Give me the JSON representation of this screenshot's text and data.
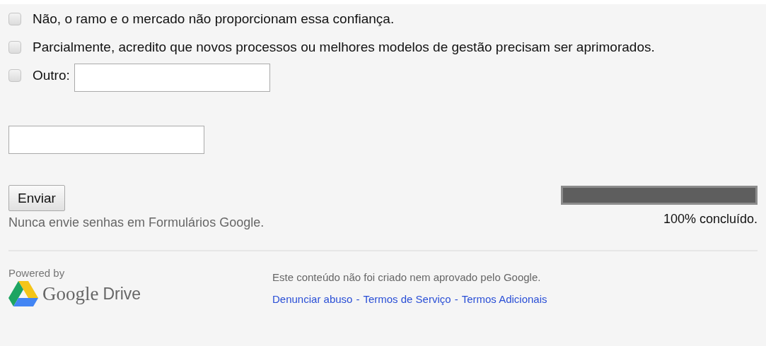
{
  "options": [
    {
      "kind": "plain",
      "label": "Não, o ramo e o mercado não proporcionam essa confiança.",
      "checked": false
    },
    {
      "kind": "plain",
      "label": "Parcialmente, acredito que novos processos ou melhores modelos de gestão precisam ser aprimorados.",
      "checked": false
    },
    {
      "kind": "other",
      "label": "Outro:",
      "checked": false
    }
  ],
  "extra_field": {
    "kind": "text"
  },
  "submit": {
    "label": "Enviar"
  },
  "warning": "Nunca envie senhas em Formulários Google.",
  "progress": {
    "level": 1,
    "label": "100% concluído."
  },
  "footer": {
    "powered_by": "Powered by",
    "logo_word": "Google",
    "logo_product": "Drive",
    "disclaimer": "Este conteúdo não foi criado nem aprovado pelo Google.",
    "separator": "-",
    "links": [
      "Denunciar abuso",
      "Termos de Serviço",
      "Termos Adicionais"
    ]
  }
}
